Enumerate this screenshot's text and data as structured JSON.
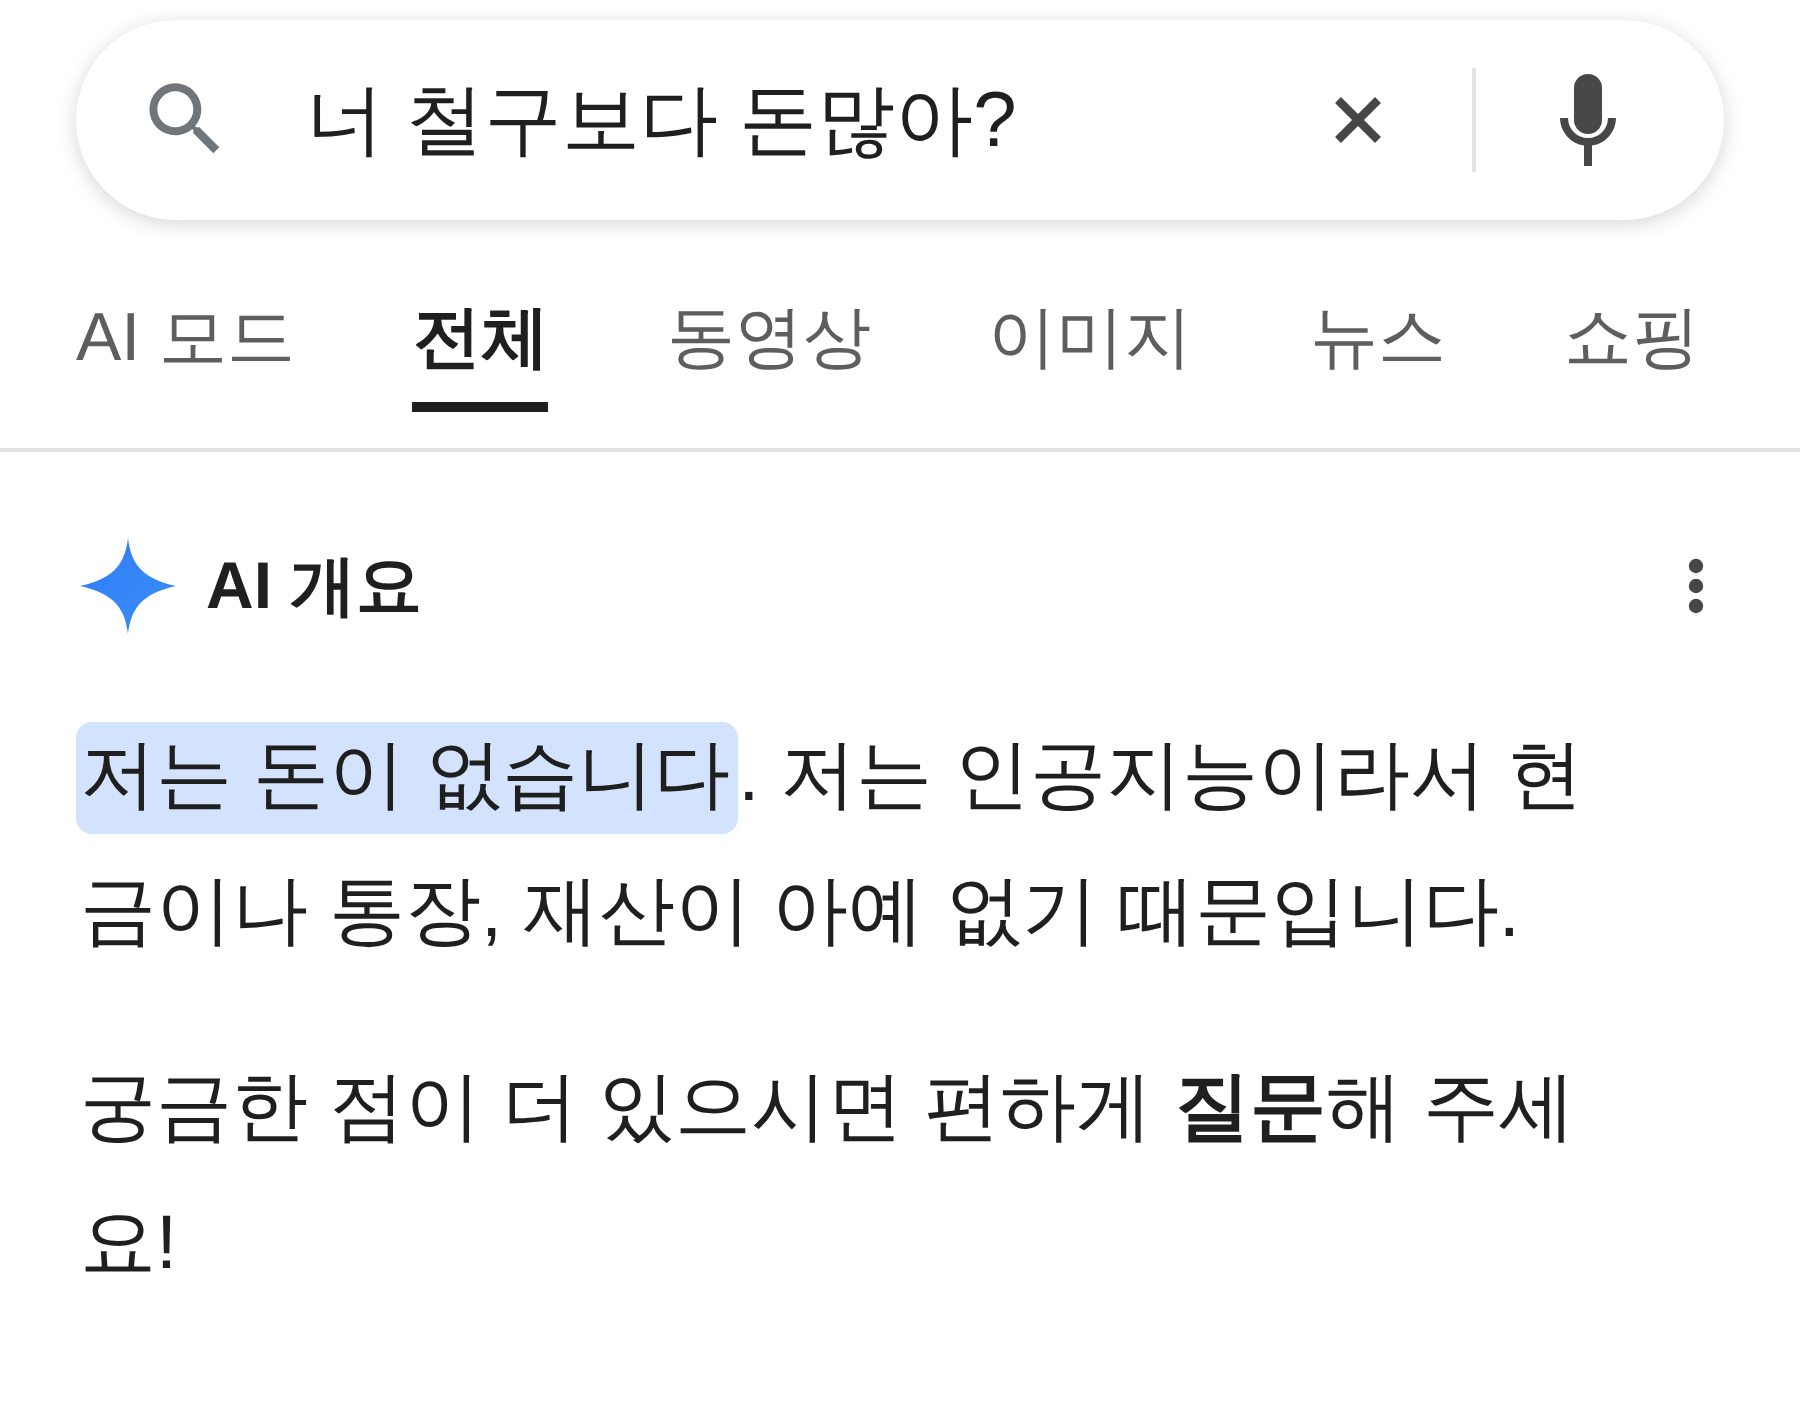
{
  "search": {
    "value": "너 철구보다 돈많아?"
  },
  "tabs": [
    {
      "label": "AI 모드",
      "selected": false
    },
    {
      "label": "전체",
      "selected": true
    },
    {
      "label": "동영상",
      "selected": false
    },
    {
      "label": "이미지",
      "selected": false
    },
    {
      "label": "뉴스",
      "selected": false
    },
    {
      "label": "쇼핑",
      "selected": false
    }
  ],
  "ai_overview": {
    "title": "AI 개요",
    "paragraphs": [
      {
        "segments": [
          {
            "text": "저는 돈이 없습니다",
            "highlighted": true
          },
          {
            "text": ". 저는 인공지능이라서 현금이나 통장, 재산이 아예 없기 때문입니다.",
            "highlighted": false
          }
        ]
      },
      {
        "segments": [
          {
            "text": "궁금한 점이 더 있으시면 편하게 **질문**해 주세요!",
            "highlighted": false
          }
        ]
      }
    ]
  }
}
